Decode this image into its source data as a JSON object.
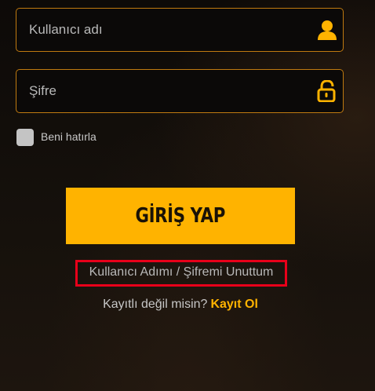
{
  "form": {
    "username": {
      "placeholder": "Kullanıcı adı",
      "value": "",
      "icon": "user-icon"
    },
    "password": {
      "placeholder": "Şifre",
      "value": "",
      "icon": "unlock-icon"
    },
    "remember_label": "Beni hatırla",
    "submit_label": "GİRİŞ YAP",
    "forgot_label": "Kullanıcı Adımı / Şifremi Unuttum",
    "register_prompt": "Kayıtlı değil misin?",
    "register_link": "Kayıt Ol"
  },
  "colors": {
    "accent": "#ffb300",
    "field_border": "#c07a10",
    "highlight_box": "#e8001a"
  }
}
